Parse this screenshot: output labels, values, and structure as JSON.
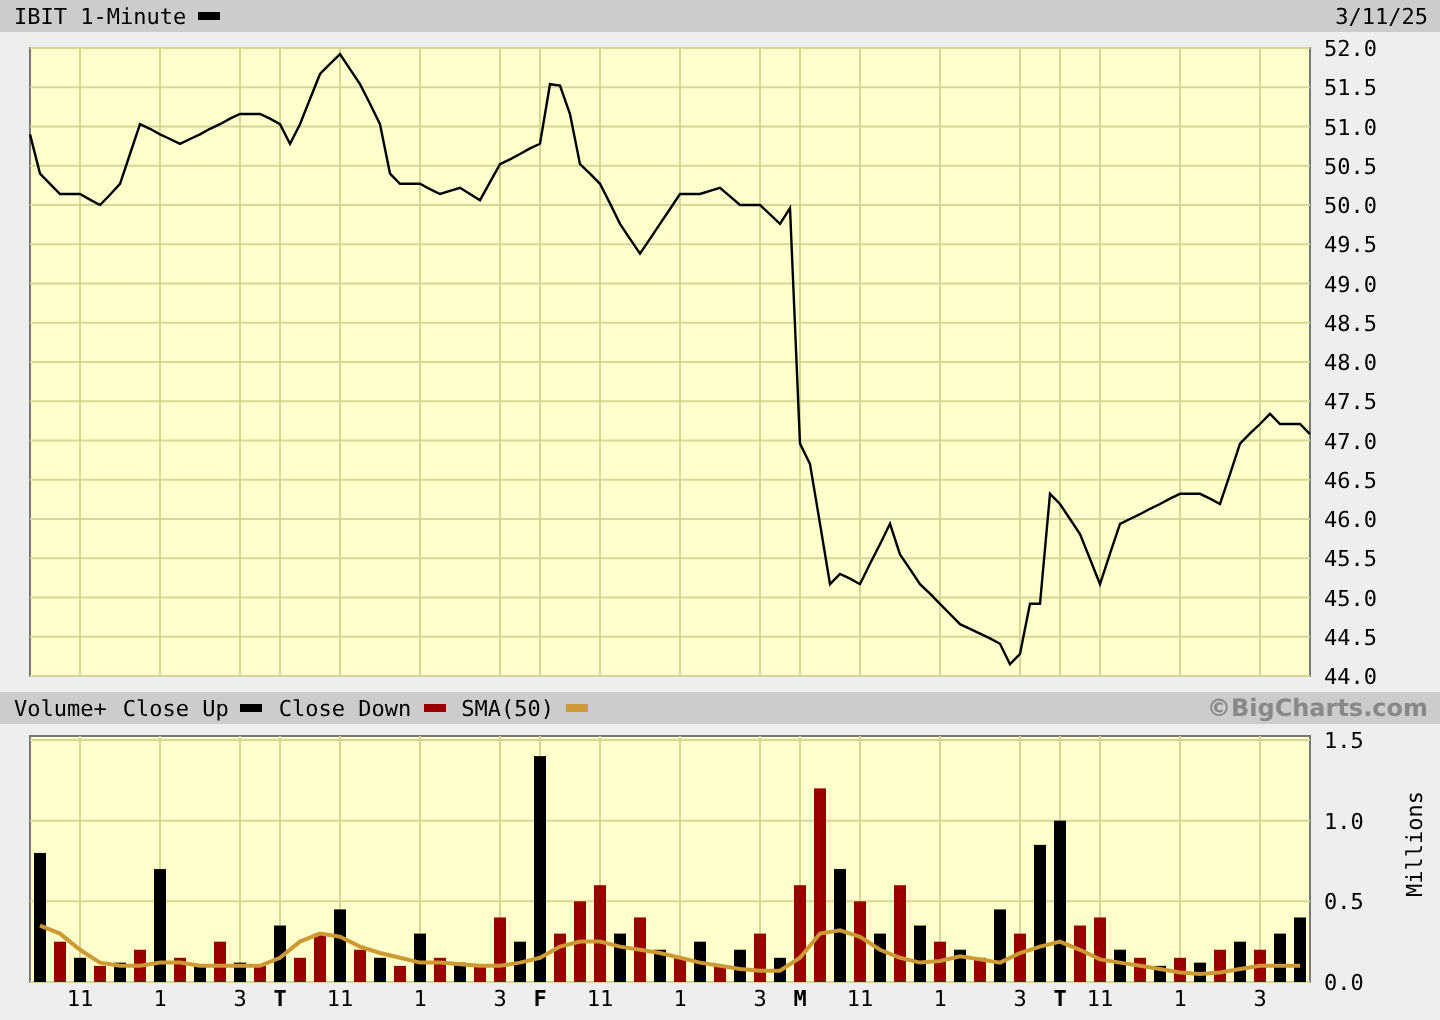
{
  "header": {
    "date": "3/11/25"
  },
  "price_chart": {
    "chart_data": {
      "type": "line",
      "ylim": [
        44,
        52
      ],
      "grid": true,
      "categories": [
        null,
        null,
        null,
        null,
        null,
        null,
        null,
        null,
        null,
        null,
        null,
        null,
        null,
        null,
        null,
        null,
        null,
        null,
        null,
        null,
        null,
        null,
        null,
        null,
        null,
        null,
        null,
        null,
        null,
        null,
        null,
        null,
        null,
        null,
        null,
        null,
        null,
        null,
        null,
        null,
        null,
        null,
        null,
        null,
        null,
        null,
        null,
        null,
        null,
        null,
        null,
        null,
        null,
        null,
        null,
        null,
        null,
        null,
        null,
        null,
        null,
        null,
        null,
        null,
        null,
        null,
        null,
        null,
        null,
        null,
        null,
        null,
        null,
        null,
        null,
        null,
        null,
        null,
        null,
        null,
        null,
        null,
        null,
        null,
        null,
        null,
        null,
        null,
        null,
        null,
        null,
        null,
        null,
        null,
        null,
        null,
        null,
        null,
        null,
        null,
        null,
        null,
        null,
        null,
        null,
        null,
        null,
        null,
        null,
        null,
        null,
        null,
        null,
        null,
        null,
        null,
        null,
        null,
        null,
        null,
        null,
        null,
        null,
        null,
        null,
        null,
        null,
        null,
        null
      ],
      "series": [
        {
          "name": "IBIT 1-Minute",
          "color": "#000000",
          "values": [
            50.9,
            50.4,
            50.27,
            50.14,
            50.14,
            50.14,
            50.07,
            50.0,
            50.13,
            50.27,
            50.65,
            51.03,
            50.97,
            50.9,
            50.84,
            50.78,
            50.84,
            50.9,
            50.97,
            51.03,
            51.1,
            51.16,
            51.16,
            51.16,
            51.1,
            51.03,
            50.78,
            51.03,
            51.35,
            51.67,
            51.8,
            51.92,
            51.73,
            51.54,
            51.29,
            51.03,
            50.4,
            50.27,
            50.27,
            50.27,
            50.2,
            50.14,
            50.18,
            50.22,
            50.14,
            50.06,
            50.29,
            50.52,
            50.58,
            50.65,
            50.72,
            50.78,
            51.54,
            51.52,
            51.16,
            50.52,
            50.4,
            50.27,
            50.02,
            49.76,
            49.57,
            49.38,
            49.57,
            49.76,
            49.95,
            50.14,
            50.14,
            50.14,
            50.18,
            50.22,
            50.11,
            50.0,
            50.0,
            50.0,
            49.88,
            49.76,
            49.96,
            46.96,
            46.7,
            45.94,
            45.17,
            45.3,
            45.24,
            45.17,
            45.43,
            45.68,
            45.94,
            45.55,
            45.36,
            45.17,
            45.05,
            44.92,
            44.79,
            44.66,
            44.6,
            44.54,
            44.48,
            44.41,
            44.15,
            44.28,
            44.92,
            44.92,
            46.32,
            46.19,
            46.0,
            45.81,
            45.49,
            45.17,
            45.56,
            45.94,
            46.0,
            46.06,
            46.13,
            46.19,
            46.26,
            46.32,
            46.32,
            46.32,
            46.26,
            46.19,
            46.57,
            46.96,
            47.09,
            47.21,
            47.34,
            47.21,
            47.21,
            47.21,
            47.08
          ]
        }
      ],
      "yticks": [
        {
          "value": 44,
          "label": "44.0"
        },
        {
          "value": 44.5,
          "label": "44.5"
        },
        {
          "value": 45,
          "label": "45.0"
        },
        {
          "value": 45.5,
          "label": "45.5"
        },
        {
          "value": 46,
          "label": "46.0"
        },
        {
          "value": 46.5,
          "label": "46.5"
        },
        {
          "value": 47,
          "label": "47.0"
        },
        {
          "value": 47.5,
          "label": "47.5"
        },
        {
          "value": 48,
          "label": "48.0"
        },
        {
          "value": 48.5,
          "label": "48.5"
        },
        {
          "value": 49,
          "label": "49.0"
        },
        {
          "value": 49.5,
          "label": "49.5"
        },
        {
          "value": 50,
          "label": "50.0"
        },
        {
          "value": 50.5,
          "label": "50.5"
        },
        {
          "value": 51,
          "label": "51.0"
        },
        {
          "value": 51.5,
          "label": "51.5"
        },
        {
          "value": 52,
          "label": "52.0"
        }
      ]
    }
  },
  "volume_legend": {
    "title": "Volume+",
    "credit": "©BigCharts.com"
  },
  "volume_chart": {
    "chart_data": {
      "type": "bar",
      "ylabel": "Millions",
      "ylim": [
        0,
        1.5
      ],
      "grid": true,
      "categories": [
        null,
        null,
        "11",
        null,
        null,
        null,
        "1",
        null,
        null,
        null,
        "3",
        null,
        "T",
        null,
        null,
        "11",
        null,
        null,
        null,
        "1",
        null,
        null,
        null,
        "3",
        null,
        "F",
        null,
        null,
        "11",
        null,
        null,
        null,
        "1",
        null,
        null,
        null,
        "3",
        null,
        "M",
        null,
        null,
        "11",
        null,
        null,
        null,
        "1",
        null,
        null,
        null,
        "3",
        null,
        "T",
        null,
        "11",
        null,
        null,
        null,
        "1",
        null,
        null,
        null,
        "3",
        null,
        null
      ],
      "series": [
        {
          "name": "Close Up",
          "color": "#000000",
          "values": [
            0.8,
            null,
            0.15,
            null,
            0.12,
            null,
            0.7,
            null,
            0.1,
            null,
            0.12,
            null,
            0.35,
            null,
            null,
            0.45,
            null,
            0.15,
            null,
            0.3,
            null,
            0.12,
            null,
            null,
            0.25,
            1.4,
            null,
            null,
            null,
            0.3,
            null,
            0.2,
            null,
            0.25,
            null,
            0.2,
            null,
            0.15,
            null,
            null,
            0.7,
            null,
            0.3,
            null,
            0.35,
            null,
            0.2,
            null,
            0.45,
            null,
            0.85,
            1.0,
            null,
            null,
            0.2,
            null,
            0.1,
            null,
            0.12,
            null,
            0.25,
            null,
            0.3,
            0.4
          ]
        },
        {
          "name": "Close Down",
          "color": "#990000",
          "values": [
            null,
            0.25,
            null,
            0.1,
            null,
            0.2,
            null,
            0.15,
            null,
            0.25,
            null,
            0.1,
            null,
            0.15,
            0.3,
            null,
            0.2,
            null,
            0.1,
            null,
            0.15,
            null,
            0.1,
            0.4,
            null,
            null,
            0.3,
            0.5,
            0.6,
            null,
            0.4,
            null,
            0.15,
            null,
            0.1,
            null,
            0.3,
            null,
            0.6,
            1.2,
            null,
            0.5,
            null,
            0.6,
            null,
            0.25,
            null,
            0.15,
            null,
            0.3,
            null,
            null,
            0.35,
            0.4,
            null,
            0.15,
            null,
            0.15,
            null,
            0.2,
            null,
            0.2,
            null,
            null
          ]
        },
        {
          "name": "SMA(50)",
          "color": "#cc9933",
          "type": "line",
          "values": [
            0.35,
            0.3,
            0.2,
            0.12,
            0.1,
            0.1,
            0.12,
            0.12,
            0.1,
            0.1,
            0.1,
            0.1,
            0.15,
            0.25,
            0.3,
            0.28,
            0.22,
            0.18,
            0.15,
            0.12,
            0.12,
            0.11,
            0.1,
            0.1,
            0.12,
            0.15,
            0.22,
            0.25,
            0.25,
            0.22,
            0.2,
            0.18,
            0.15,
            0.12,
            0.1,
            0.08,
            0.07,
            0.07,
            0.15,
            0.3,
            0.32,
            0.28,
            0.2,
            0.15,
            0.12,
            0.13,
            0.16,
            0.14,
            0.12,
            0.18,
            0.22,
            0.25,
            0.2,
            0.14,
            0.12,
            0.1,
            0.08,
            0.06,
            0.05,
            0.06,
            0.08,
            0.1,
            0.1,
            0.1
          ]
        }
      ],
      "yticks": [
        {
          "value": 0,
          "label": "0.0"
        },
        {
          "value": 0.5,
          "label": "0.5"
        },
        {
          "value": 1,
          "label": "1.0"
        },
        {
          "value": 1.5,
          "label": "1.5"
        }
      ]
    }
  }
}
